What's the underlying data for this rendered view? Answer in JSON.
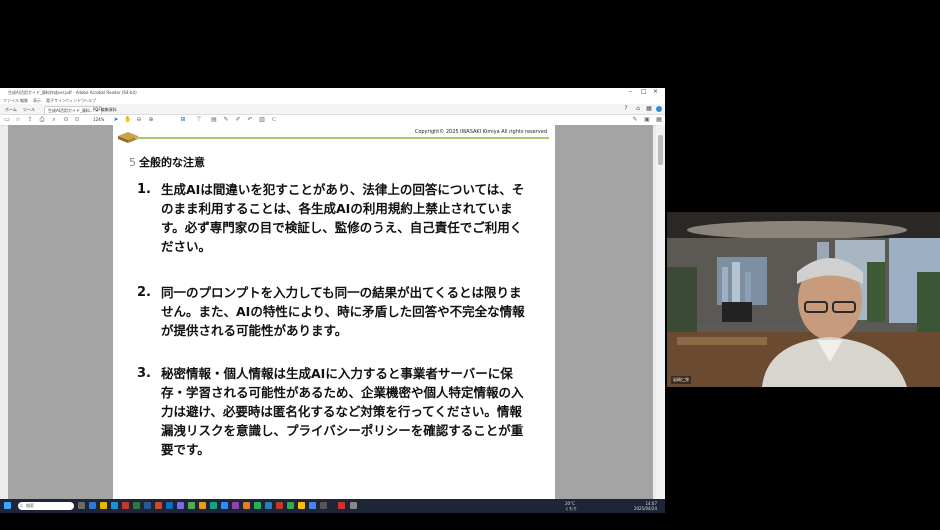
{
  "window": {
    "title": "生成AI活用ガイド_資料作成ver.pdf - Adobe Acrobat Reader (64-bit)",
    "menu": [
      "ファイル",
      "編集",
      "表示",
      "電子サイン",
      "ウィンドウ",
      "ヘルプ"
    ],
    "tabs": [
      {
        "label": "ホーム"
      },
      {
        "label": "ツール"
      },
      {
        "label": "生成AI活用ガイド_資料... ×",
        "active": true
      },
      {
        "label": "PDF編集資料"
      }
    ],
    "zoom": "124%"
  },
  "slide": {
    "copyright": "Copyright© 2025 IWASAKI Kimiya All rights reserved",
    "page_number": "5",
    "heading": "全般的な注意",
    "items": [
      {
        "num": "1.",
        "text": "生成AIは間違いを犯すことがあり、法律上の回答については、そのまま利用することは、各生成AIの利用規約上禁止されています。必ず専門家の目で検証し、監修のうえ、自己責任でご利用ください。"
      },
      {
        "num": "2.",
        "text": "同一のプロンプトを入力しても同一の結果が出てくるとは限りません。また、AIの特性により、時に矛盾した回答や不完全な情報が提供される可能性があります。"
      },
      {
        "num": "3.",
        "text": "秘密情報・個人情報は生成AIに入力すると事業者サーバーに保存・学習される可能性があるため、企業機密や個人特定情報の入力は避け、必要時は匿名化するなど対策を行ってください。情報漏洩リスクを意識し、プライバシーポリシーを確認することが重要です。"
      }
    ]
  },
  "taskbar": {
    "search_placeholder": "検索",
    "weather": "20°C",
    "weather_desc": "くもり",
    "time": "14:07",
    "date": "2025/04/24"
  },
  "video": {
    "participant_name": "岩崎仁弥"
  },
  "colors": {
    "accent_green": "#a8c96a",
    "taskbar": "#1d2536",
    "viewer_bg": "#a4a4a4"
  }
}
